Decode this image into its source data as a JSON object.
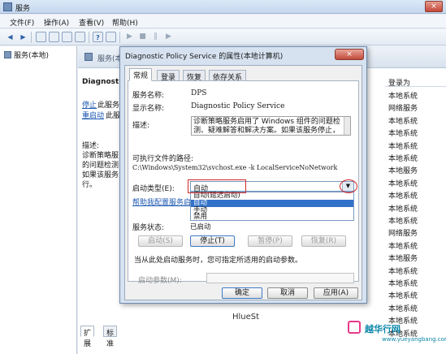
{
  "window": {
    "title": "服务",
    "close_icon": "×"
  },
  "menu": [
    "文件(F)",
    "操作(A)",
    "查看(V)",
    "帮助(H)"
  ],
  "toolbar": {
    "back_icon": "◀",
    "forward_icon": "▶",
    "help_icon": "?",
    "play_icon": "▶",
    "stop_icon": "■",
    "pause_icon": "‖",
    "restart_icon": "▶"
  },
  "tree": {
    "item": "服务(本地)"
  },
  "pane": {
    "header": "服务(本地)",
    "service_title": "Diagnostic",
    "stop_link": "停止",
    "stop_rest": "此服务",
    "restart_link": "重启动",
    "restart_rest": "此服务",
    "description_label": "描述:",
    "description_lines": [
      "诊断策略服",
      "的问题检测",
      "如果该服务",
      "行。"
    ],
    "column_header": "登录为",
    "logon_values": [
      "本地系统",
      "网络服务",
      "本地系统",
      "本地系统",
      "本地系统",
      "本地系统",
      "本地服务",
      "本地系统",
      "本地系统",
      "本地系统",
      "本地系统",
      "网络服务",
      "本地系统",
      "本地服务",
      "本地系统",
      "本地系统",
      "本地系统",
      "本地系统",
      "本地系统",
      "本地系统"
    ],
    "tabs": [
      "扩展",
      "标准"
    ]
  },
  "dialog": {
    "title": "Diagnostic Policy Service 的属性(本地计算机)",
    "close_icon": "×",
    "tabs": [
      "常规",
      "登录",
      "恢复",
      "依存关系"
    ],
    "service_name_label": "服务名称:",
    "service_name": "DPS",
    "display_name_label": "显示名称:",
    "display_name": "Diagnostic Policy Service",
    "description_label": "描述:",
    "description": "诊断策略服务启用了 Windows 组件的问题检测、疑难解答和解决方案。如果该服务停止，",
    "path_label": "可执行文件的路径:",
    "path": "C:\\Windows\\System32\\svchost.exe -k LocalServiceNoNetwork",
    "startup_type_label": "启动类型(E):",
    "startup_type_value": "自动",
    "dropdown_icon": "▼",
    "startup_options": [
      "自动(延迟启动)",
      "自动",
      "手动",
      "禁用"
    ],
    "help_link": "帮助我配置服务启动",
    "status_label": "服务状态:",
    "status_value": "已启动",
    "buttons": {
      "start": "启动(S)",
      "stop": "停止(T)",
      "pause": "暂停(P)",
      "resume": "恢复(R)"
    },
    "hint": "当从此处启动服务时，您可指定所适用的启动参数。",
    "param_label": "启动参数(M):",
    "footer_buttons": {
      "ok": "确定",
      "cancel": "取消",
      "apply": "应用(A)"
    }
  },
  "watermark": {
    "text": "HlueSt",
    "brand": "越华行网",
    "url": "www.yueyangbang.com"
  }
}
